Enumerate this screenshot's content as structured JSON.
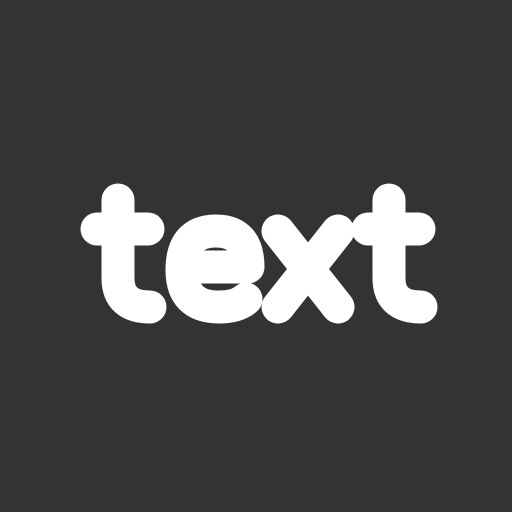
{
  "word": "text",
  "colors": {
    "background": "#333333",
    "foreground": "#ffffff"
  }
}
